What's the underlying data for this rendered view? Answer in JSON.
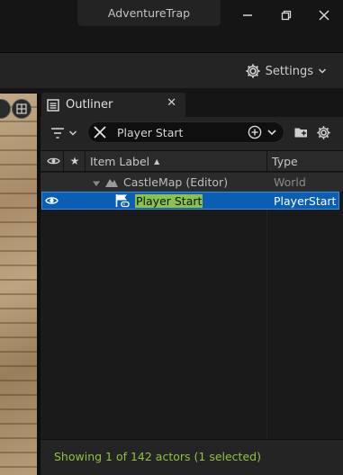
{
  "window": {
    "title": "AdventureTrap",
    "controls": [
      "minimize-icon",
      "restore-icon",
      "close-icon"
    ]
  },
  "toolbar": {
    "settings_label": "Settings"
  },
  "outliner": {
    "tab_label": "Outliner",
    "search": {
      "value": "Player Start",
      "placeholder": ""
    },
    "columns": {
      "visibility": "eye-icon",
      "pinned": "star-icon",
      "item_label": "Item Label",
      "sort_indicator": "▲",
      "type": "Type"
    },
    "rows": [
      {
        "label": "CastleMap (Editor)",
        "type": "World",
        "icon": "map-icon",
        "expanded": true,
        "selected": false
      },
      {
        "label": "Player Start",
        "type": "PlayerStart",
        "icon": "player-start-icon",
        "selected": true,
        "highlight": "Player Start"
      }
    ],
    "status": "Showing 1 of 142 actors (1 selected)"
  },
  "colors": {
    "selection": "#0a5fb4",
    "search_highlight": "#8bc34a",
    "status_text": "#8fc33f",
    "panel_bg": "#1a1a1a"
  }
}
